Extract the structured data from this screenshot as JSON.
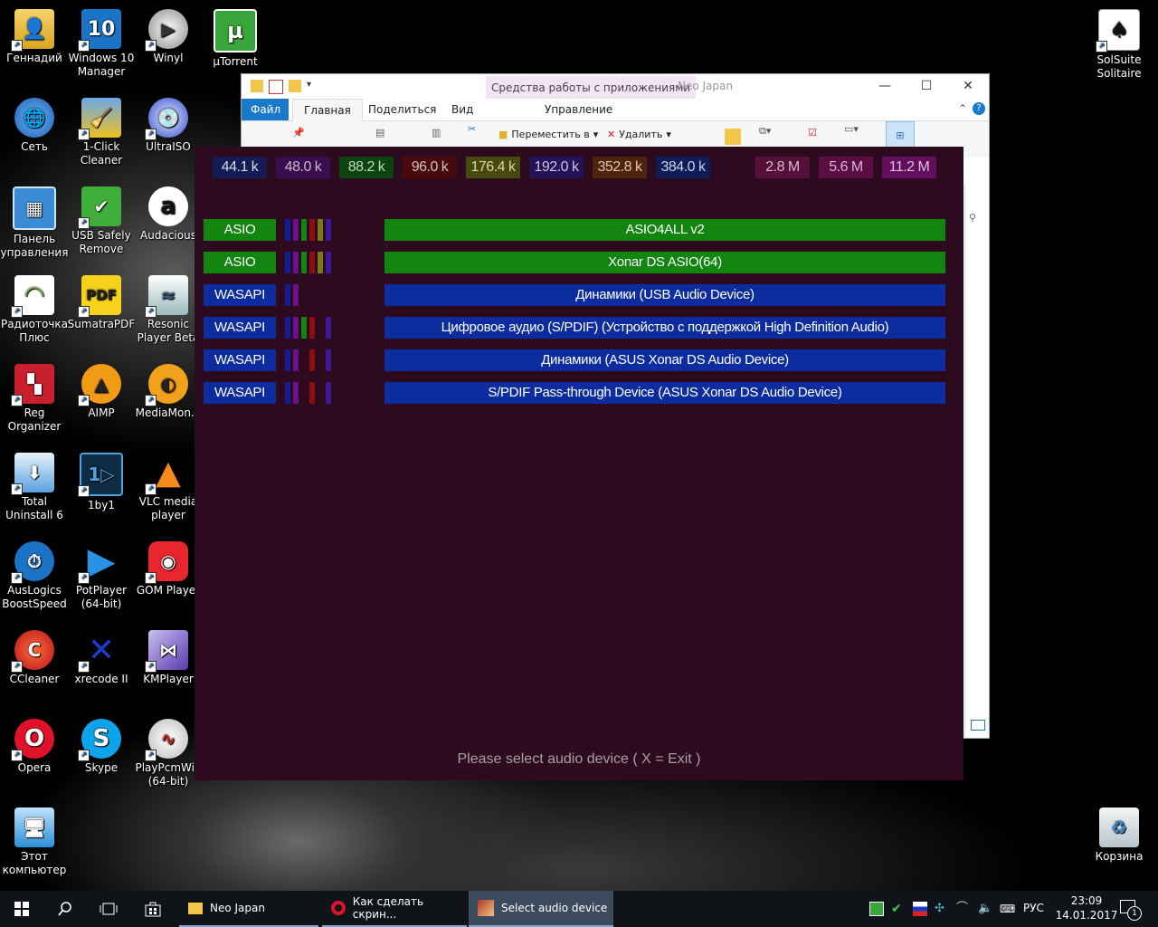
{
  "desktop": {
    "icons": [
      {
        "label": "Геннадий"
      },
      {
        "label": "Windows 10 Manager"
      },
      {
        "label": "Winyl"
      },
      {
        "label": "µTorrent"
      },
      {
        "label": "Сеть"
      },
      {
        "label": "1-Click Cleaner"
      },
      {
        "label": "UltraISO"
      },
      {
        "label": "Панель управления"
      },
      {
        "label": "USB Safely Remove"
      },
      {
        "label": "Audacious"
      },
      {
        "label": "Радиоточка Плюс"
      },
      {
        "label": "SumatraPDF"
      },
      {
        "label": "Resonic Player Beta"
      },
      {
        "label": "Reg Organizer"
      },
      {
        "label": "AIMP"
      },
      {
        "label": "MediaMon..."
      },
      {
        "label": "Total Uninstall 6"
      },
      {
        "label": "1by1"
      },
      {
        "label": "VLC media player"
      },
      {
        "label": "AusLogics BoostSpeed"
      },
      {
        "label": "PotPlayer (64-bit)"
      },
      {
        "label": "GOM Player"
      },
      {
        "label": "CCleaner"
      },
      {
        "label": "xrecode II"
      },
      {
        "label": "KMPlayer"
      },
      {
        "label": "Opera"
      },
      {
        "label": "Skype"
      },
      {
        "label": "PlayPcmWin (64-bit)"
      },
      {
        "label": "Этот компьютер"
      },
      {
        "label": "SolSuite Solitaire"
      },
      {
        "label": "Корзина"
      }
    ]
  },
  "explorer": {
    "context_tab": "Средства работы с приложениями",
    "title": "Neo Japan",
    "tabs": [
      "Файл",
      "Главная",
      "Поделиться",
      "Вид",
      "Управление"
    ],
    "ribbon": {
      "move_to": "Переместить в",
      "delete": "Удалить"
    },
    "controls": {
      "minimize": "—",
      "maximize": "☐",
      "close": "✕",
      "help": "?",
      "collapse": "⌃"
    }
  },
  "audio_app": {
    "sample_rates": [
      {
        "label": "44.1 k",
        "bg": "#151c55",
        "fg": "#d8d8e8"
      },
      {
        "label": "48.0 k",
        "bg": "#3a0e4e",
        "fg": "#c8b8cc"
      },
      {
        "label": "88.2 k",
        "bg": "#0c4410",
        "fg": "#c0d8c0"
      },
      {
        "label": "96.0 k",
        "bg": "#480a0c",
        "fg": "#d8c0c0"
      },
      {
        "label": "176.4 k",
        "bg": "#464a0e",
        "fg": "#d8d8a8"
      },
      {
        "label": "192.0 k",
        "bg": "#241358",
        "fg": "#c8c8e0"
      },
      {
        "label": "352.8 k",
        "bg": "#4e250c",
        "fg": "#e0c8b0"
      },
      {
        "label": "384.0 k",
        "bg": "#0e1c58",
        "fg": "#c8d0e8"
      },
      {
        "label": "2.8 M",
        "bg": "#54103a",
        "fg": "#d8b8c8"
      },
      {
        "label": "5.6 M",
        "bg": "#5a0e44",
        "fg": "#d8b8cc"
      },
      {
        "label": "11.2 M",
        "bg": "#640e5e",
        "fg": "#e0c0dc"
      }
    ],
    "devices": [
      {
        "api": "ASIO",
        "name": "ASIO4ALL v2",
        "api_bg": "#11850f",
        "name_bg": "#11850f",
        "swatches": [
          "#151c9c",
          "#6a1288",
          "#11850f",
          "#8a1010",
          "#7a7a10",
          "#3a1a9a"
        ]
      },
      {
        "api": "ASIO",
        "name": "Xonar DS ASIO(64)",
        "api_bg": "#11850f",
        "name_bg": "#11850f",
        "swatches": [
          "#151c9c",
          "#6a1288",
          "#11850f",
          "#8a1010",
          "#7a7a10",
          "#3a1a9a"
        ]
      },
      {
        "api": "WASAPI",
        "name": "Динамики (USB Audio Device)",
        "api_bg": "#0d2ca0",
        "name_bg": "#0d2ca0",
        "swatches": [
          "#151c9c",
          "#6a1288"
        ]
      },
      {
        "api": "WASAPI",
        "name": "Цифровое аудио (S/PDIF) (Устройство с поддержкой High Definition Audio)",
        "api_bg": "#0d2ca0",
        "name_bg": "#0d2ca0",
        "swatches": [
          "#151c9c",
          "#6a1288",
          "#11850f",
          "#8a1010",
          "",
          "#3a1a9a"
        ]
      },
      {
        "api": "WASAPI",
        "name": "Динамики (ASUS Xonar DS Audio Device)",
        "api_bg": "#0d2ca0",
        "name_bg": "#0d2ca0",
        "swatches": [
          "#151c9c",
          "#6a1288",
          "",
          "#8a1010",
          "",
          "#3a1a9a"
        ]
      },
      {
        "api": "WASAPI",
        "name": "S/PDIF Pass-through Device (ASUS Xonar DS Audio Device)",
        "api_bg": "#0d2ca0",
        "name_bg": "#0d2ca0",
        "swatches": [
          "#151c9c",
          "#6a1288",
          "",
          "#8a1010",
          "",
          "#3a1a9a"
        ]
      }
    ],
    "status": "Please select audio device  ( X = Exit )",
    "bg": "#2d0a1d"
  },
  "taskbar": {
    "tasks": [
      {
        "label": "Neo Japan"
      },
      {
        "label": "Как сделать скрин..."
      },
      {
        "label": "Select audio device"
      }
    ],
    "tray": {
      "language": "РУС",
      "time": "23:09",
      "date": "14.01.2017",
      "notifications": "1"
    }
  }
}
